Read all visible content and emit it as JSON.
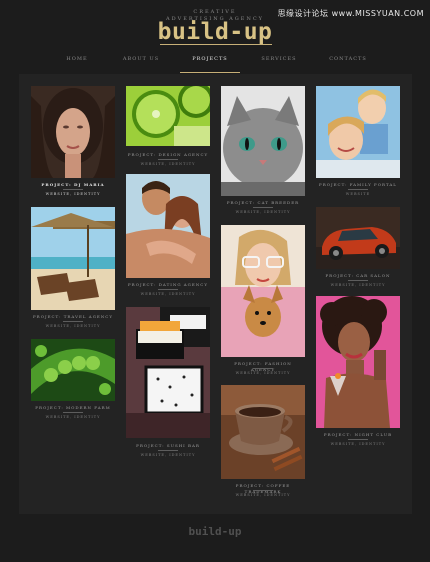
{
  "watermark": "思缘设计论坛 www.MISSYUAN.COM",
  "header": {
    "tagline_1": "CREATIVE",
    "tagline_2": "ADVERTISING AGENCY",
    "logo": "build-up"
  },
  "nav": {
    "items": [
      "HOME",
      "ABOUT US",
      "PROJECTS",
      "SERVICES",
      "CONTACTS"
    ],
    "active": "PROJECTS"
  },
  "projects": [
    {
      "title": "PROJECT: DJ MARIA",
      "sub": "WEBSITE, IDENTITY",
      "image": "woman-portrait-photo"
    },
    {
      "title": "PROJECT: DESIGN AGENCY",
      "sub": "WEBSITE, IDENTITY",
      "image": "lime-slices-photo"
    },
    {
      "title": "PROJECT: CAT BREEDER",
      "sub": "WEBSITE, IDENTITY",
      "image": "grey-kitten-photo"
    },
    {
      "title": "PROJECT: FAMILY PORTAL",
      "sub": "WEBSITE",
      "image": "mother-child-photo"
    },
    {
      "title": "PROJECT: DATING AGENCY",
      "sub": "WEBSITE, IDENTITY",
      "image": "couple-photo"
    },
    {
      "title": "PROJECT: TRAVEL AGENCY",
      "sub": "WEBSITE, IDENTITY",
      "image": "beach-chairs-photo"
    },
    {
      "title": "PROJECT: FASHION AGENCY",
      "sub": "WEBSITE, IDENTITY",
      "image": "woman-with-dog-photo"
    },
    {
      "title": "PROJECT: CAR SALON",
      "sub": "WEBSITE, IDENTITY",
      "image": "red-car-photo"
    },
    {
      "title": "PROJECT: MODERN FARM",
      "sub": "WEBSITE, IDENTITY",
      "image": "green-peas-photo"
    },
    {
      "title": "PROJECT: SUSHI BAR",
      "sub": "WEBSITE, IDENTITY",
      "image": "sushi-photo"
    },
    {
      "title": "PROJECT: NIGHT CLUB",
      "sub": "WEBSITE, IDENTITY",
      "image": "curly-hair-woman-photo"
    },
    {
      "title": "PROJECT: COFFEE TRADEMARK",
      "sub": "WEBSITE, IDENTITY",
      "image": "coffee-cup-photo"
    }
  ],
  "footer": {
    "logo": "build-up"
  }
}
